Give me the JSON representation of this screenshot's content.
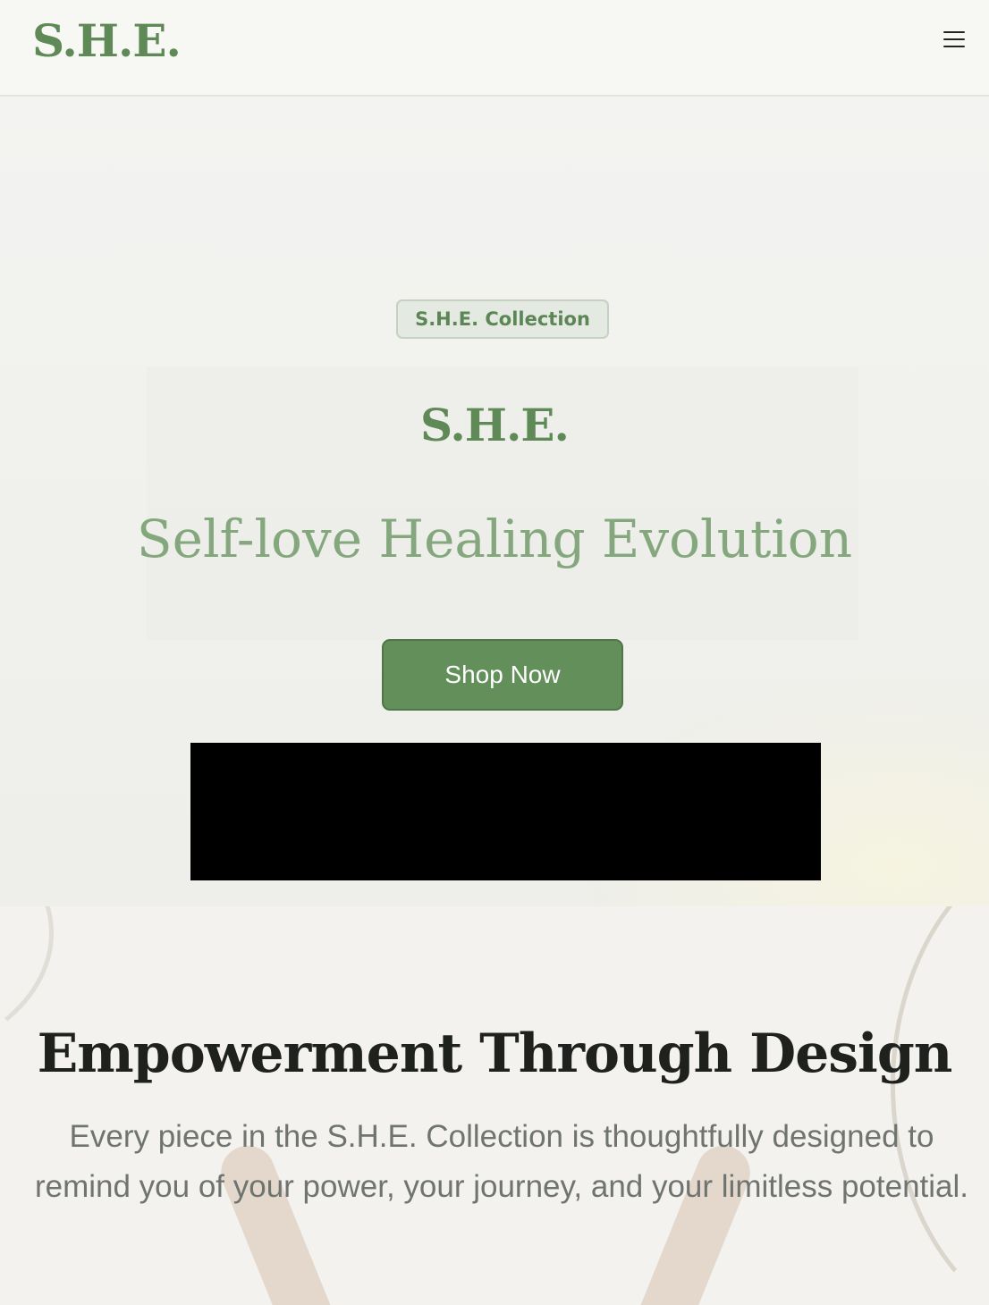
{
  "header": {
    "logo": "S.H.E.",
    "menu_icon": "hamburger-menu-icon"
  },
  "hero": {
    "badge": "S.H.E. Collection",
    "brand": "S.H.E.",
    "tagline": "Self-love Healing Evolution",
    "cta_label": "Shop Now"
  },
  "section": {
    "title": "Empowerment Through Design",
    "body": "Every piece in the S.H.E. Collection is thoughtfully designed to remind you of your power, your journey, and your limitless potential."
  },
  "colors": {
    "brand_green": "#5f8a58",
    "button_green": "#638f5b",
    "tagline_green": "#85a77d",
    "heading_dark": "#1e211e",
    "body_gray": "#707470"
  }
}
